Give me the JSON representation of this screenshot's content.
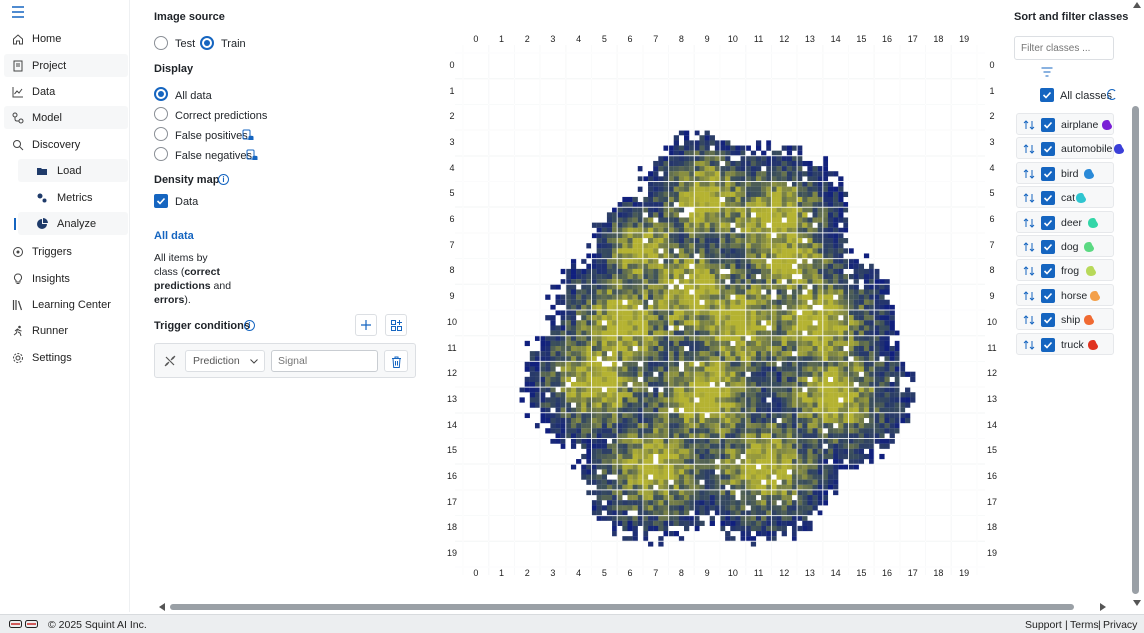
{
  "sidebar": {
    "items": [
      {
        "label": "Home",
        "icon": "home-icon"
      },
      {
        "label": "Project",
        "icon": "project-icon"
      },
      {
        "label": "Data",
        "icon": "data-icon"
      },
      {
        "label": "Model",
        "icon": "model-icon"
      },
      {
        "label": "Discovery",
        "icon": "discovery-icon"
      },
      {
        "label": "Load",
        "icon": "folder-icon"
      },
      {
        "label": "Metrics",
        "icon": "metrics-icon"
      },
      {
        "label": "Analyze",
        "icon": "analyze-icon"
      },
      {
        "label": "Triggers",
        "icon": "triggers-icon"
      },
      {
        "label": "Insights",
        "icon": "insights-icon"
      },
      {
        "label": "Learning Center",
        "icon": "learning-icon"
      },
      {
        "label": "Runner",
        "icon": "runner-icon"
      },
      {
        "label": "Settings",
        "icon": "settings-icon"
      }
    ]
  },
  "panel": {
    "image_source_title": "Image source",
    "source_test": "Test",
    "source_train": "Train",
    "display_title": "Display",
    "display_options": [
      "All data",
      "Correct predictions",
      "False positives",
      "False negatives"
    ],
    "density_title": "Density map",
    "density_data": "Data",
    "selection_title": "All data",
    "desc_pre": "All items by class (",
    "desc_bold1": "correct predictions",
    "desc_mid": " and ",
    "desc_bold2": "errors",
    "desc_post": ").",
    "trigger_title": "Trigger conditions",
    "trigger_select": "Prediction",
    "trigger_placeholder": "Signal"
  },
  "grid": {
    "x_ticks": [
      "0",
      "1",
      "2",
      "3",
      "4",
      "5",
      "6",
      "7",
      "8",
      "9",
      "10",
      "11",
      "12",
      "13",
      "14",
      "15",
      "16",
      "17",
      "18",
      "19"
    ],
    "y_ticks": [
      "0",
      "1",
      "2",
      "3",
      "4",
      "5",
      "6",
      "7",
      "8",
      "9",
      "10",
      "11",
      "12",
      "13",
      "14",
      "15",
      "16",
      "17",
      "18",
      "19"
    ],
    "colors": {
      "low": "#101f7e",
      "mid": "#3a4e5c",
      "high": "#b5b332"
    }
  },
  "right": {
    "title": "Sort and filter classes",
    "filter_placeholder": "Filter classes ...",
    "all_classes": "All classes",
    "classes": [
      {
        "name": "airplane",
        "color": "#7a1fd6"
      },
      {
        "name": "automobile",
        "color": "#3b3fd8"
      },
      {
        "name": "bird",
        "color": "#2a8ad8"
      },
      {
        "name": "cat",
        "color": "#2fc5d0"
      },
      {
        "name": "deer",
        "color": "#33d6a8"
      },
      {
        "name": "dog",
        "color": "#5bd982"
      },
      {
        "name": "frog",
        "color": "#b8d95a"
      },
      {
        "name": "horse",
        "color": "#f3a04a"
      },
      {
        "name": "ship",
        "color": "#f06a32"
      },
      {
        "name": "truck",
        "color": "#e0321f"
      }
    ]
  },
  "footer": {
    "copyright": "© 2025 Squint AI Inc.",
    "support": "Support",
    "terms": "Terms",
    "privacy": "Privacy"
  }
}
